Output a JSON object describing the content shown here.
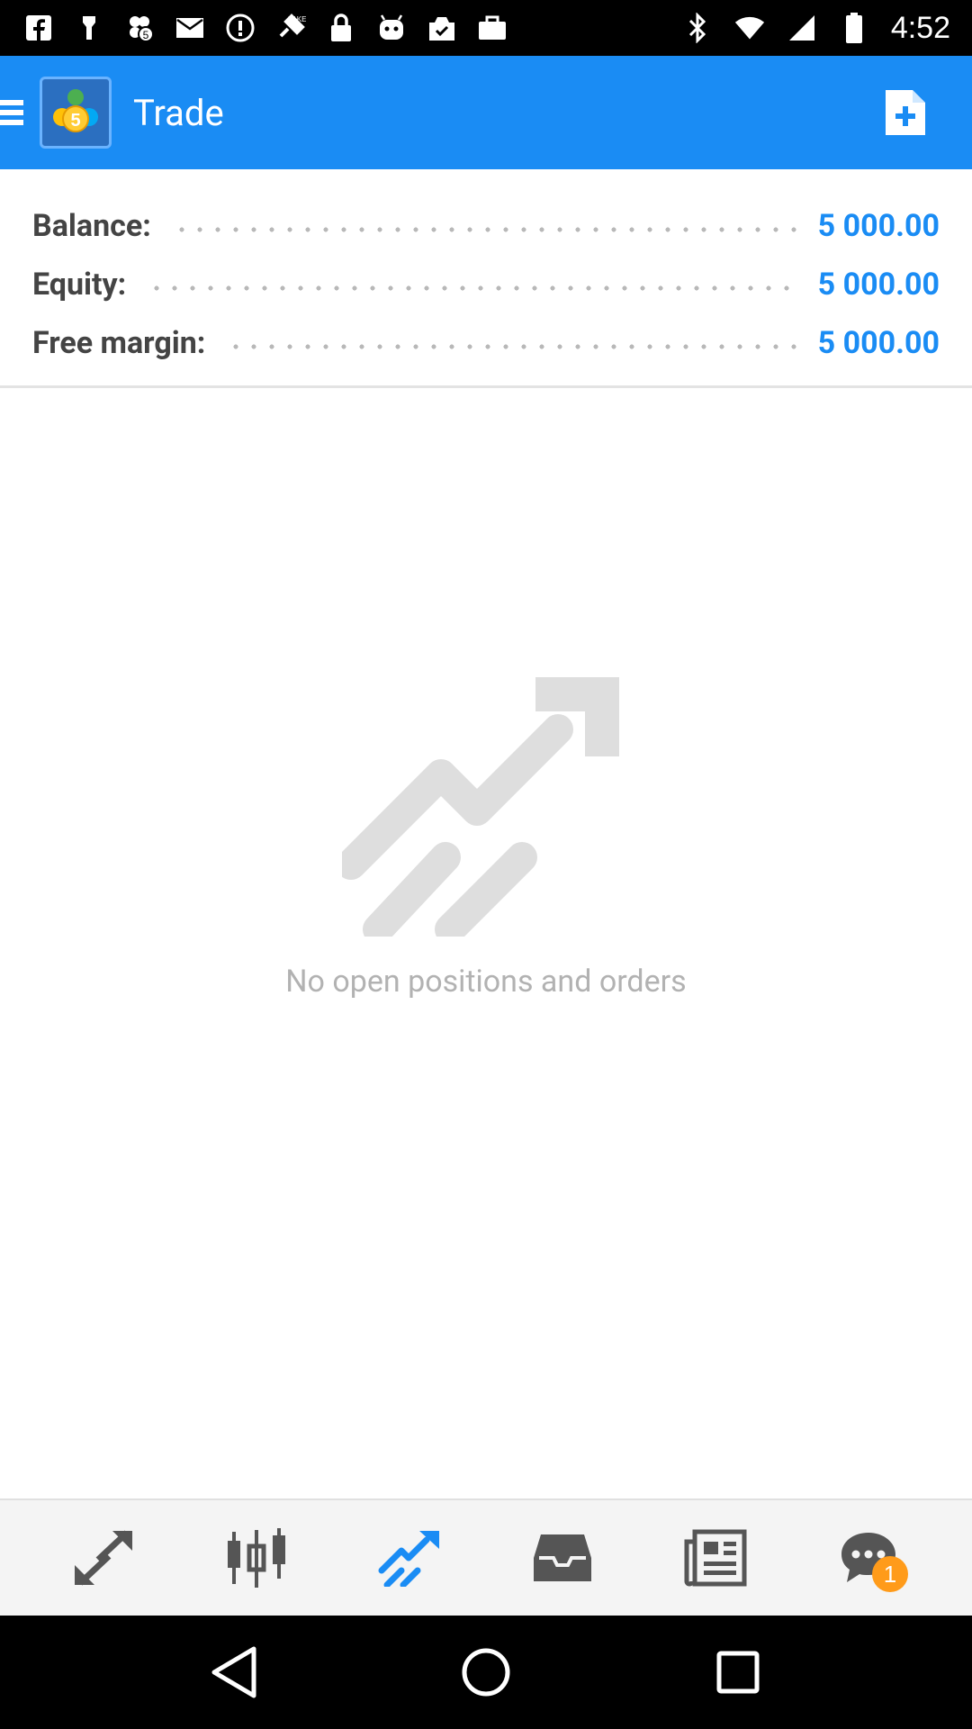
{
  "status_bar": {
    "time": "4:52",
    "left_icons": [
      "facebook-icon",
      "flashlight-icon",
      "app-icon",
      "email-icon",
      "alert-icon",
      "fake-gps-icon",
      "lock-icon",
      "android-icon",
      "checklist-icon",
      "briefcase-icon"
    ],
    "right_icons": [
      "bluetooth-icon",
      "wifi-icon",
      "signal-icon",
      "battery-icon"
    ]
  },
  "app_bar": {
    "title": "Trade",
    "logo_text": "5",
    "accent": "#1a8cf4"
  },
  "account": {
    "rows": [
      {
        "label": "Balance:",
        "value": "5 000.00"
      },
      {
        "label": "Equity:",
        "value": "5 000.00"
      },
      {
        "label": "Free margin:",
        "value": "5 000.00"
      }
    ]
  },
  "empty_state": {
    "message": "No open positions and orders",
    "icon": "trend-up-icon"
  },
  "bottom_nav": {
    "items": [
      {
        "name": "quotes",
        "icon": "quotes-arrows-icon",
        "active": false
      },
      {
        "name": "charts",
        "icon": "candlestick-icon",
        "active": false
      },
      {
        "name": "trade",
        "icon": "trend-up-icon",
        "active": true
      },
      {
        "name": "history",
        "icon": "inbox-icon",
        "active": false
      },
      {
        "name": "news",
        "icon": "newspaper-icon",
        "active": false
      },
      {
        "name": "messages",
        "icon": "chat-icon",
        "active": false,
        "badge": "1"
      }
    ]
  },
  "system_nav": [
    "back-icon",
    "home-icon",
    "recents-icon"
  ]
}
